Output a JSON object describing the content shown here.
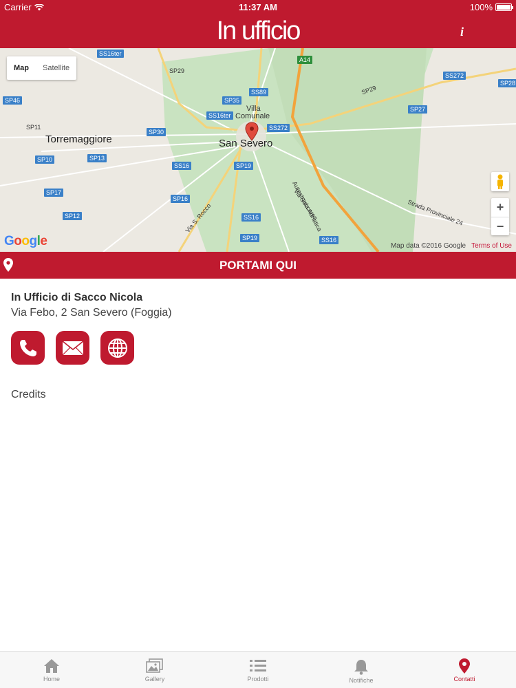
{
  "status_bar": {
    "carrier": "Carrier",
    "time": "11:37 AM",
    "battery": "100%"
  },
  "header": {
    "title": "In ufficio",
    "info_icon": "info-icon"
  },
  "map": {
    "type_control": {
      "map": "Map",
      "satellite": "Satellite"
    },
    "city_labels": [
      "Torremaggiore",
      "San Severo",
      "Villa",
      "Comunale"
    ],
    "road_labels": [
      "SS16ter",
      "SP29",
      "A14",
      "SS272",
      "SP28",
      "SP46",
      "SS89",
      "SP35",
      "SP29",
      "SS16ter",
      "SP27",
      "SP11",
      "SP30",
      "SS272",
      "SP10",
      "SP13",
      "SS16",
      "SP19",
      "SP17",
      "SP16",
      "SP12",
      "SS16",
      "SP19",
      "SS16"
    ],
    "street_labels": [
      "Autostrada Adriatica",
      "Via S. Rocco",
      "Via Soccorso",
      "Strada Provinciale 24"
    ],
    "google_logo": "Google",
    "attribution": "Map data ©2016 Google",
    "terms": "Terms of Use",
    "zoom_in": "+",
    "zoom_out": "−"
  },
  "directions_button": {
    "label": "PORTAMI QUI"
  },
  "business": {
    "name": "In Ufficio di Sacco Nicola",
    "address": "Via Febo, 2 San Severo (Foggia)"
  },
  "actions": [
    {
      "name": "call",
      "icon": "phone-icon"
    },
    {
      "name": "email",
      "icon": "envelope-icon"
    },
    {
      "name": "website",
      "icon": "globe-icon"
    }
  ],
  "credits_label": "Credits",
  "tabs": [
    {
      "label": "Home",
      "icon": "home-icon",
      "active": false
    },
    {
      "label": "Gallery",
      "icon": "gallery-icon",
      "active": false
    },
    {
      "label": "Prodotti",
      "icon": "list-icon",
      "active": false
    },
    {
      "label": "Notifiche",
      "icon": "bell-icon",
      "active": false
    },
    {
      "label": "Contatti",
      "icon": "map-pin-icon",
      "active": true
    }
  ],
  "colors": {
    "brand": "#bf1a2f",
    "map_green": "#c9e3c1",
    "highway": "#f2a33c"
  }
}
